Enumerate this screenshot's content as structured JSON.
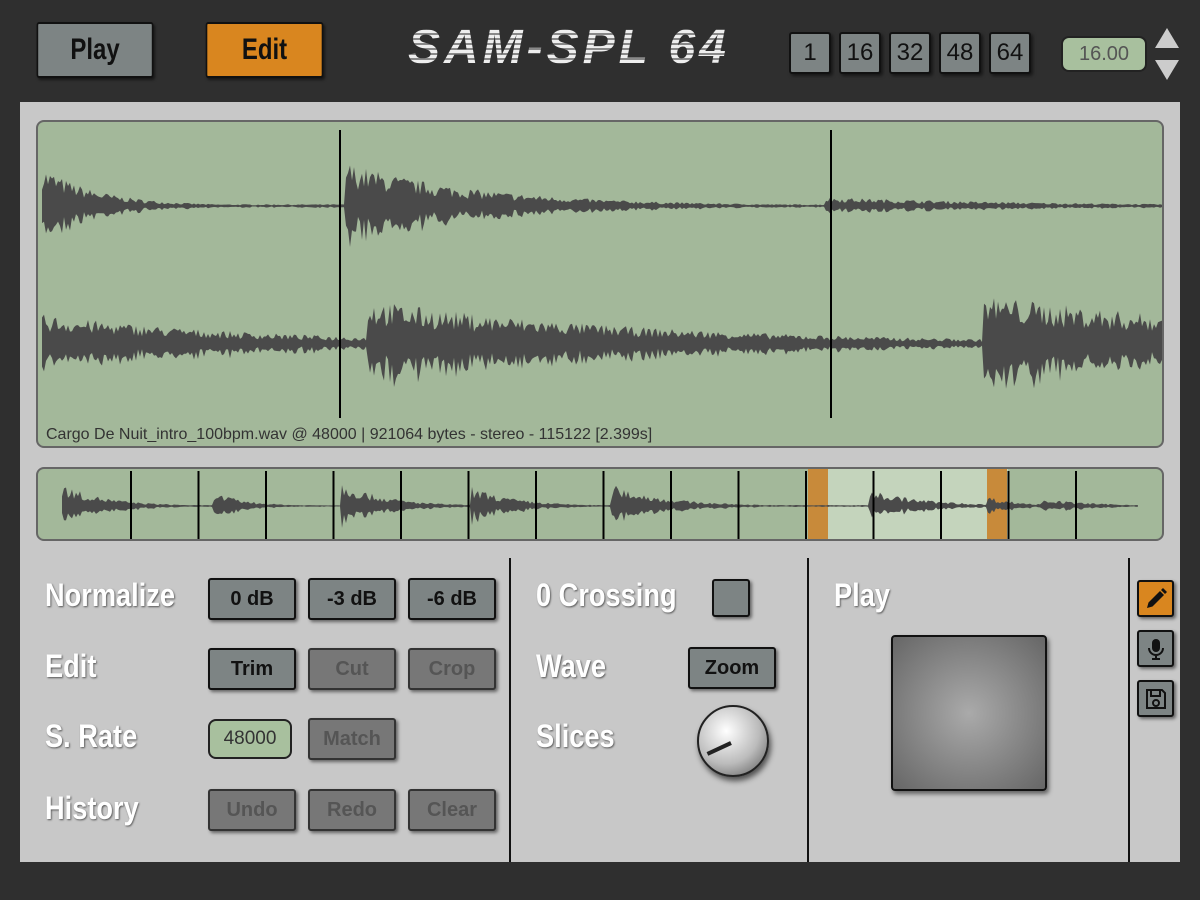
{
  "header": {
    "play_label": "Play",
    "edit_label": "Edit",
    "title": "SAM-SPL 64",
    "slice_counts": [
      "1",
      "16",
      "32",
      "48",
      "64"
    ],
    "value": "16.00",
    "up_icon": "triangle-up-icon",
    "down_icon": "triangle-down-icon"
  },
  "wave": {
    "info": "Cargo De Nuit_intro_100bpm.wav @ 48000 | 921064 bytes - stereo - 115122 [2.399s]"
  },
  "controls": {
    "normalize": {
      "label": "Normalize",
      "buttons": [
        "0 dB",
        "-3 dB",
        "-6 dB"
      ]
    },
    "edit": {
      "label": "Edit",
      "buttons": [
        "Trim",
        "Cut",
        "Crop"
      ]
    },
    "srate": {
      "label": "S. Rate",
      "value": "48000",
      "match": "Match"
    },
    "history": {
      "label": "History",
      "buttons": [
        "Undo",
        "Redo",
        "Clear"
      ]
    },
    "zero_crossing": {
      "label": "0 Crossing",
      "checked": false
    },
    "wave": {
      "label": "Wave",
      "zoom": "Zoom"
    },
    "slices": {
      "label": "Slices"
    },
    "play": {
      "label": "Play"
    }
  },
  "side_tools": [
    "pencil-icon",
    "microphone-icon",
    "save-icon"
  ],
  "colors": {
    "accent": "#d9861f",
    "wave_bg": "#a3b89a",
    "wave": "#4a4a4a"
  }
}
